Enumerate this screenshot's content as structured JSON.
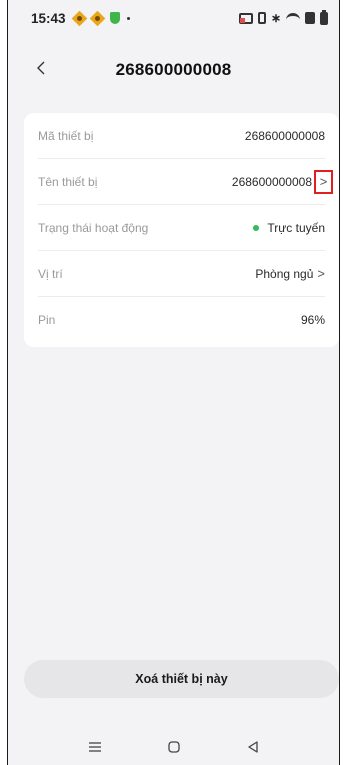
{
  "status_bar": {
    "time": "15:43",
    "bluetooth_glyph": "∗"
  },
  "header": {
    "title": "268600000008"
  },
  "device_info": {
    "rows": [
      {
        "label": "Mã thiết bị",
        "value": "268600000008"
      },
      {
        "label": "Tên thiết bị",
        "value": "268600000008"
      },
      {
        "label": "Trạng thái hoạt động",
        "value": "Trực tuyến"
      },
      {
        "label": "Vị trí",
        "value": "Phòng ngủ"
      },
      {
        "label": "Pin",
        "value": "96%"
      }
    ]
  },
  "colors": {
    "online_status": "#2ebd59",
    "highlight_box": "#e02020"
  },
  "actions": {
    "delete_label": "Xoá thiết bị này"
  },
  "icons": {
    "back": "chevron-left-icon",
    "row_arrow": "chevron-right-icon",
    "nav_menu": "menu-icon",
    "nav_home": "home-icon",
    "nav_back": "triangle-back-icon"
  }
}
